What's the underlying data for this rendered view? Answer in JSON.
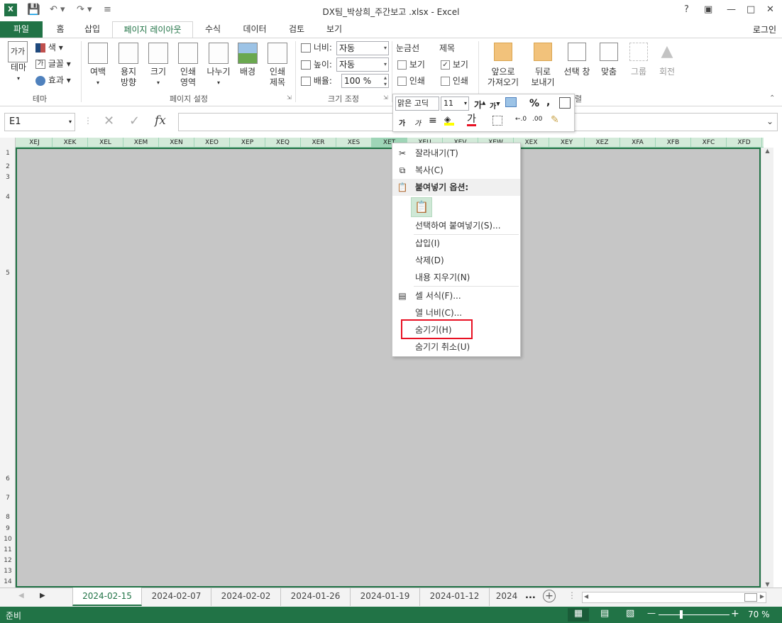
{
  "app": {
    "title": "DX팀_박상희_주간보고 .xlsx - Excel",
    "help": "?",
    "login": "로그인"
  },
  "tabs": [
    "파일",
    "홈",
    "삽입",
    "페이지 레이아웃",
    "수식",
    "데이터",
    "검토",
    "보기"
  ],
  "ribbon": {
    "theme": {
      "themes": "테마",
      "colors": "색",
      "fonts": "글꼴",
      "effects": "효과",
      "group": "테마"
    },
    "page_setup": {
      "margins": "여백",
      "orientation": "용지\n방향",
      "size": "크기",
      "print_area": "인쇄\n영역",
      "breaks": "나누기",
      "background": "배경",
      "print_titles": "인쇄\n제목",
      "group": "페이지 설정"
    },
    "scale": {
      "width_label": "너비:",
      "width_value": "자동",
      "height_label": "높이:",
      "height_value": "자동",
      "scale_label": "배율:",
      "scale_value": "100 %",
      "group": "크기 조정"
    },
    "sheet_options": {
      "gridlines": "눈금선",
      "headings": "제목",
      "view": "보기",
      "print": "인쇄"
    },
    "arrange": {
      "bring_forward": "앞으로\n가져오기",
      "send_backward": "뒤로\n보내기",
      "selection_pane": "선택 창",
      "align": "맞춤",
      "group_btn": "그룹",
      "rotate": "회전",
      "group": "정렬"
    }
  },
  "formula_bar": {
    "name_box": "E1",
    "fx": "fx",
    "value": ""
  },
  "columns": [
    "XEJ",
    "XEK",
    "XEL",
    "XEM",
    "XEN",
    "XEO",
    "XEP",
    "XEQ",
    "XER",
    "XES",
    "XET",
    "XEU",
    "XEV",
    "XEW",
    "XEX",
    "XEY",
    "XEZ",
    "XFA",
    "XFB",
    "XFC",
    "XFD"
  ],
  "rows": [
    "1",
    "2",
    "3",
    "4",
    "5",
    "6",
    "7",
    "8",
    "9",
    "10",
    "11",
    "12",
    "13",
    "14"
  ],
  "mini_toolbar": {
    "font": "맑은 고딕",
    "size": "11"
  },
  "context_menu": {
    "cut": "잘라내기(T)",
    "copy": "복사(C)",
    "paste_options": "붙여넣기 옵션:",
    "paste_special": "선택하여 붙여넣기(S)...",
    "insert": "삽입(I)",
    "delete": "삭제(D)",
    "clear": "내용 지우기(N)",
    "format_cells": "셀 서식(F)...",
    "column_width": "열 너비(C)...",
    "hide": "숨기기(H)",
    "unhide": "숨기기 취소(U)"
  },
  "sheets": [
    "2024-02-15",
    "2024-02-07",
    "2024-02-02",
    "2024-01-26",
    "2024-01-19",
    "2024-01-12",
    "2024"
  ],
  "sheet_more": "...",
  "status": {
    "ready": "준비",
    "zoom": "70 %"
  },
  "colors": {
    "accent": "#217346",
    "highlight": "#e81123"
  }
}
